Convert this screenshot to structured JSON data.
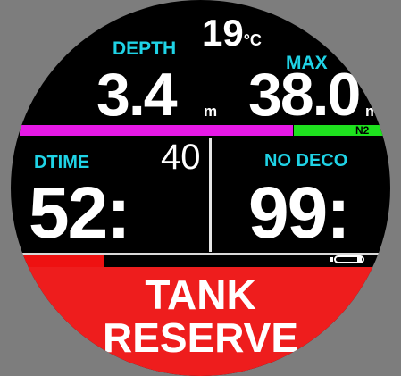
{
  "temperature": {
    "value": "19",
    "unit": "°C"
  },
  "depth": {
    "label": "DEPTH",
    "value": "3.4",
    "unit": "m"
  },
  "max": {
    "label": "MAX",
    "value": "38.0",
    "unit": "m"
  },
  "bars": {
    "gas_label": "N2",
    "magenta_color": "#e619e6",
    "green_color": "#1ee11e"
  },
  "dtime": {
    "label": "DTIME",
    "extra": "40",
    "value": "52:"
  },
  "nodeco": {
    "label": "NO DECO",
    "value": "99:"
  },
  "alarm": {
    "line1": "TANK",
    "line2": "RESERVE",
    "color": "#ee1d1d"
  },
  "colors": {
    "cyan": "#1fd3e6",
    "white": "#ffffff",
    "background": "#000000"
  },
  "icons": {
    "battery": "battery-icon"
  }
}
